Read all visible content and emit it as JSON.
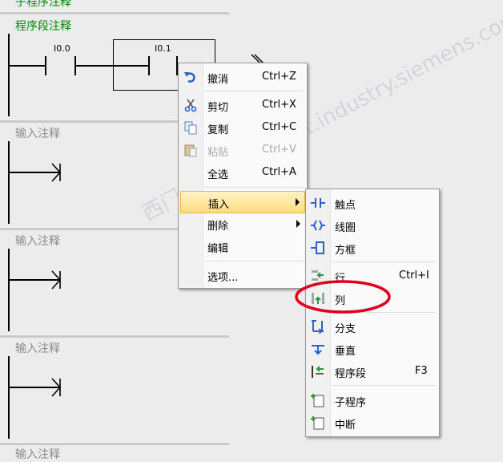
{
  "editor": {
    "top_comment": "子程序注释",
    "network1_comment": "程序段注释",
    "contact1_label": "I0.0",
    "contact2_label": "I0.1",
    "input_comment": "输入注释"
  },
  "context_menu": {
    "items": [
      {
        "label": "撤消",
        "shortcut": "Ctrl+Z",
        "icon": "undo-icon"
      },
      {
        "label": "剪切",
        "shortcut": "Ctrl+X",
        "icon": "scissors-icon"
      },
      {
        "label": "复制",
        "shortcut": "Ctrl+C",
        "icon": "copy-icon"
      },
      {
        "label": "粘贴",
        "shortcut": "Ctrl+V",
        "icon": "paste-icon",
        "disabled": true
      },
      {
        "label": "全选",
        "shortcut": "Ctrl+A"
      },
      {
        "label": "插入",
        "submenu": true,
        "highlighted": true
      },
      {
        "label": "删除",
        "submenu": true
      },
      {
        "label": "编辑"
      },
      {
        "label": "选项..."
      }
    ]
  },
  "insert_submenu": {
    "items": [
      {
        "label": "触点",
        "icon": "contact-icon"
      },
      {
        "label": "线圈",
        "icon": "coil-icon"
      },
      {
        "label": "方框",
        "icon": "box-icon"
      },
      {
        "label": "行",
        "shortcut": "Ctrl+I",
        "icon": "insert-row-icon"
      },
      {
        "label": "列",
        "icon": "insert-column-icon"
      },
      {
        "label": "分支",
        "icon": "branch-icon"
      },
      {
        "label": "垂直",
        "icon": "vertical-icon"
      },
      {
        "label": "程序段",
        "shortcut": "F3",
        "icon": "network-icon"
      },
      {
        "label": "子程序",
        "icon": "subroutine-icon"
      },
      {
        "label": "中断",
        "icon": "interrupt-icon"
      }
    ]
  },
  "watermark": "西门子工业 support.industry.siemens.com/cs 找答案",
  "colors": {
    "comment_green": "#008a00",
    "annotation_red": "#e0001b",
    "highlight": "#fddc7e"
  }
}
